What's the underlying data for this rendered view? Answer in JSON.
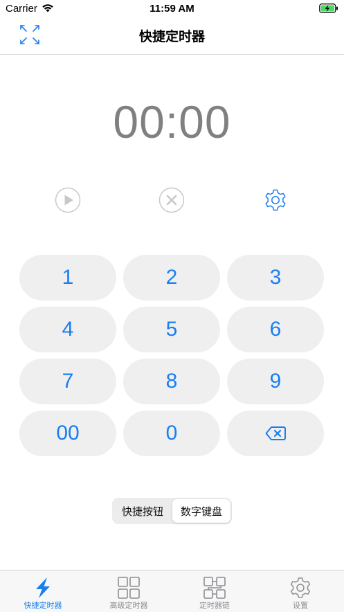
{
  "status_bar": {
    "carrier": "Carrier",
    "time": "11:59 AM"
  },
  "nav": {
    "title": "快捷定时器"
  },
  "timer": {
    "display": "00:00"
  },
  "keypad": {
    "keys": [
      "1",
      "2",
      "3",
      "4",
      "5",
      "6",
      "7",
      "8",
      "9",
      "00",
      "0"
    ]
  },
  "segmented": {
    "options": [
      "快捷按钮",
      "数字键盘"
    ],
    "selected": "数字键盘"
  },
  "tabs": [
    {
      "label": "快捷定时器",
      "icon": "lightning-icon",
      "active": true
    },
    {
      "label": "高级定时器",
      "icon": "grid-icon",
      "active": false
    },
    {
      "label": "定时器链",
      "icon": "chain-icon",
      "active": false
    },
    {
      "label": "设置",
      "icon": "gear-icon",
      "active": false
    }
  ],
  "colors": {
    "accent": "#1a7ef0",
    "inactive": "#8e8e93",
    "key_background": "#efeff0",
    "timer_text": "#808080"
  }
}
